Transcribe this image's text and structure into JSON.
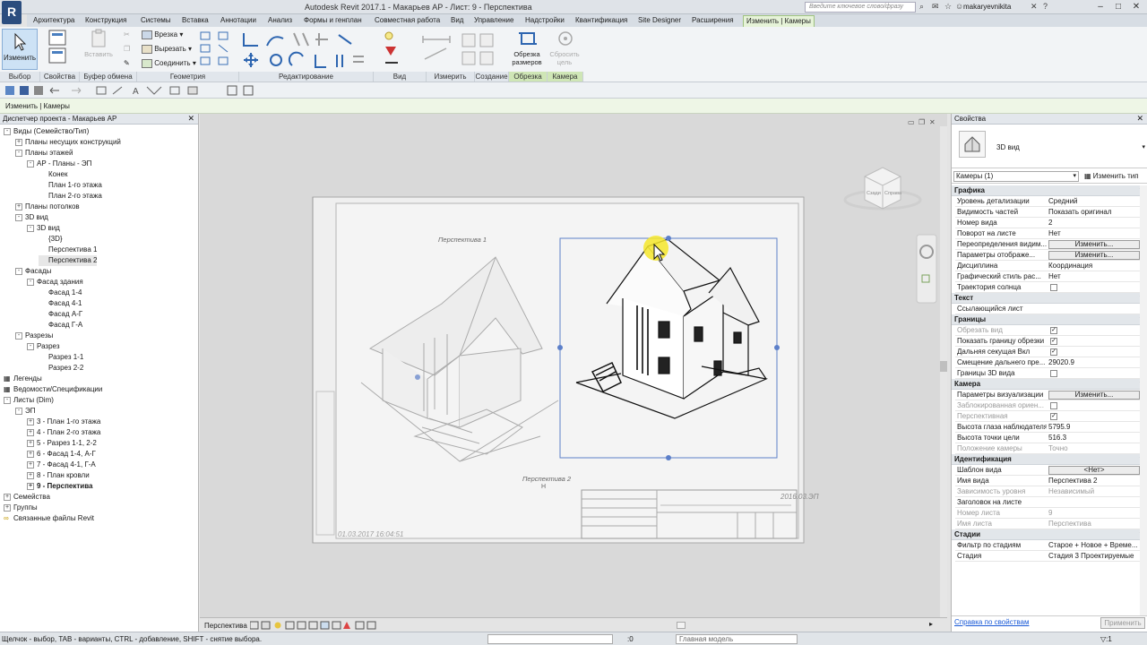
{
  "title": "Autodesk Revit 2017.1 -    Макарьев АР - Лист: 9 - Перспектива",
  "app_logo": "R",
  "search_placeholder": "Введите ключевое слово/фразу",
  "user": "makaryevnikita",
  "tabs": [
    "Архитектура",
    "Конструкция",
    "Системы",
    "Вставка",
    "Аннотации",
    "Анализ",
    "Формы и генплан",
    "Совместная работа",
    "Вид",
    "Управление",
    "Надстройки",
    "Квантификация",
    "Site Designer",
    "Расширения",
    "Изменить | Камеры"
  ],
  "ribbon": {
    "modify": "Изменить",
    "paste": "Вставить",
    "cut_geom": "Врезка",
    "cut": "Вырезать",
    "join": "Соединить",
    "crop_view": "Обрезка размеров",
    "reset_crop": "Сбросить цель",
    "panels": [
      "Выбор",
      "Свойства",
      "Буфер обмена",
      "Геометрия",
      "Редактирование",
      "Вид",
      "Измерить",
      "Создание",
      "Обрезка",
      "Камера"
    ]
  },
  "context_label": "Изменить | Камеры",
  "browser": {
    "title": "Диспетчер проекта - Макарьев АР",
    "nodes": [
      {
        "t": "Виды (Семейство/Тип)",
        "lvl": 0,
        "exp": "-"
      },
      {
        "t": "Планы несущих конструкций",
        "lvl": 1,
        "exp": "+"
      },
      {
        "t": "Планы этажей",
        "lvl": 1,
        "exp": "-"
      },
      {
        "t": "АР - Планы - ЭП",
        "lvl": 2,
        "exp": "-"
      },
      {
        "t": "Конек",
        "lvl": 3,
        "exp": ""
      },
      {
        "t": "План 1-го этажа",
        "lvl": 3,
        "exp": ""
      },
      {
        "t": "План 2-го этажа",
        "lvl": 3,
        "exp": ""
      },
      {
        "t": "Планы потолков",
        "lvl": 1,
        "exp": "+"
      },
      {
        "t": "3D вид",
        "lvl": 1,
        "exp": "-"
      },
      {
        "t": "3D вид",
        "lvl": 2,
        "exp": "-"
      },
      {
        "t": "{3D}",
        "lvl": 3,
        "exp": ""
      },
      {
        "t": "Перспектива 1",
        "lvl": 3,
        "exp": ""
      },
      {
        "t": "Перспектива 2",
        "lvl": 3,
        "exp": "",
        "sel": true
      },
      {
        "t": "Фасады",
        "lvl": 1,
        "exp": "-"
      },
      {
        "t": "Фасад здания",
        "lvl": 2,
        "exp": "-"
      },
      {
        "t": "Фасад 1-4",
        "lvl": 3,
        "exp": ""
      },
      {
        "t": "Фасад 4-1",
        "lvl": 3,
        "exp": ""
      },
      {
        "t": "Фасад А-Г",
        "lvl": 3,
        "exp": ""
      },
      {
        "t": "Фасад Г-А",
        "lvl": 3,
        "exp": ""
      },
      {
        "t": "Разрезы",
        "lvl": 1,
        "exp": "-"
      },
      {
        "t": "Разрез",
        "lvl": 2,
        "exp": "-"
      },
      {
        "t": "Разрез 1-1",
        "lvl": 3,
        "exp": ""
      },
      {
        "t": "Разрез 2-2",
        "lvl": 3,
        "exp": ""
      },
      {
        "t": "Легенды",
        "lvl": 0,
        "exp": "",
        "icon": true
      },
      {
        "t": "Ведомости/Спецификации",
        "lvl": 0,
        "exp": "",
        "icon": true
      },
      {
        "t": "Листы (Dim)",
        "lvl": 0,
        "exp": "-"
      },
      {
        "t": "ЭП",
        "lvl": 1,
        "exp": "-"
      },
      {
        "t": "3 - План 1-го этажа",
        "lvl": 2,
        "exp": "+"
      },
      {
        "t": "4 - План 2-го этажа",
        "lvl": 2,
        "exp": "+"
      },
      {
        "t": "5 - Разрез 1-1, 2-2",
        "lvl": 2,
        "exp": "+"
      },
      {
        "t": "6 - Фасад 1-4, А-Г",
        "lvl": 2,
        "exp": "+"
      },
      {
        "t": "7 - Фасад 4-1, Г-А",
        "lvl": 2,
        "exp": "+"
      },
      {
        "t": "8 - План кровли",
        "lvl": 2,
        "exp": "+"
      },
      {
        "t": "9 - Перспектива",
        "lvl": 2,
        "exp": "+",
        "bold": true
      },
      {
        "t": "Семейства",
        "lvl": 0,
        "exp": "+"
      },
      {
        "t": "Группы",
        "lvl": 0,
        "exp": "+"
      },
      {
        "t": "Связанные файлы Revit",
        "lvl": 0,
        "exp": "",
        "link": true
      }
    ]
  },
  "sheet": {
    "label1": "Перспектива 1",
    "label2": "Перспектива 2",
    "label2_sub": "H",
    "date": "2016.03.ЭП",
    "timestamp": "01.03.2017 16:04:51",
    "viewcube_left": "Сзади",
    "viewcube_right": "Справа"
  },
  "view_name": "Перспектива",
  "props": {
    "title": "Свойства",
    "type_name": "3D вид",
    "instance": "Камеры (1)",
    "edit_type": "Изменить тип",
    "groups": [
      {
        "name": "Графика",
        "rows": [
          {
            "k": "Уровень детализации",
            "v": "Средний"
          },
          {
            "k": "Видимость частей",
            "v": "Показать оригинал"
          },
          {
            "k": "Номер вида",
            "v": "2"
          },
          {
            "k": "Поворот на листе",
            "v": "Нет"
          },
          {
            "k": "Переопределения видим...",
            "btn": "Изменить..."
          },
          {
            "k": "Параметры отображе...",
            "btn": "Изменить..."
          },
          {
            "k": "Дисциплина",
            "v": "Координация"
          },
          {
            "k": "Графический стиль рас...",
            "v": "Нет"
          },
          {
            "k": "Траектория солнца",
            "chk": ""
          }
        ]
      },
      {
        "name": "Текст",
        "rows": [
          {
            "k": "Ссылающийся лист",
            "v": ""
          }
        ]
      },
      {
        "name": "Границы",
        "rows": [
          {
            "k": "Обрезать вид",
            "chk": "✓",
            "grey": true
          },
          {
            "k": "Показать границу обрезки",
            "chk": "✓"
          },
          {
            "k": "Дальняя секущая Вкл",
            "chk": "✓"
          },
          {
            "k": "Смещение дальнего пре...",
            "v": "29020.9"
          },
          {
            "k": "Границы 3D вида",
            "chk": ""
          }
        ]
      },
      {
        "name": "Камера",
        "rows": [
          {
            "k": "Параметры визуализации",
            "btn": "Изменить..."
          },
          {
            "k": "Заблокированная ориен...",
            "chk": "",
            "grey": true
          },
          {
            "k": "Перспективная",
            "chk": "✓",
            "grey": true
          },
          {
            "k": "Высота глаза наблюдателя",
            "v": "5795.9"
          },
          {
            "k": "Высота точки цели",
            "v": "516.3"
          },
          {
            "k": "Положение камеры",
            "v": "Точно",
            "grey": true
          }
        ]
      },
      {
        "name": "Идентификация",
        "rows": [
          {
            "k": "Шаблон вида",
            "btn": "<Нет>"
          },
          {
            "k": "Имя вида",
            "v": "Перспектива 2"
          },
          {
            "k": "Зависимость уровня",
            "v": "Независимый",
            "grey": true
          },
          {
            "k": "Заголовок на листе",
            "v": ""
          },
          {
            "k": "Номер листа",
            "v": "9",
            "grey": true
          },
          {
            "k": "Имя листа",
            "v": "Перспектива",
            "grey": true
          }
        ]
      },
      {
        "name": "Стадии",
        "rows": [
          {
            "k": "Фильтр по стадиям",
            "v": "Старое + Новое + Време..."
          },
          {
            "k": "Стадия",
            "v": "Стадия 3 Проектируемые"
          }
        ]
      }
    ],
    "help_link": "Справка по свойствам",
    "apply": "Применить"
  },
  "status": {
    "text": "Щелчок - выбор, TAB - варианты, CTRL - добавление, SHIFT - снятие выбора.",
    "zero": ":0",
    "model": "Главная модель",
    "filter": "▽:1"
  },
  "colors": {
    "accent_green": "#cfe6b6",
    "selection_blue": "#5c7fc9",
    "cursor_yellow": "#f4e62a"
  }
}
